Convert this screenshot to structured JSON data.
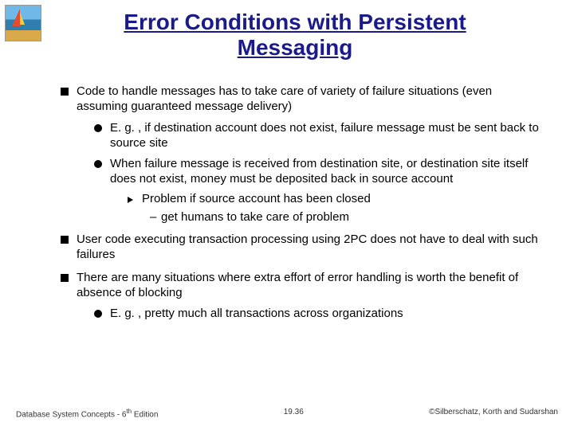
{
  "title": "Error Conditions with Persistent Messaging",
  "bullets": {
    "b1": "Code to handle messages has to take care of variety of failure situations (even assuming guaranteed message delivery)",
    "b1a": "E. g. , if destination account does not exist, failure message must be sent back to source site",
    "b1b": "When failure message is received from destination site, or destination site itself does not exist, money must be deposited back in source account",
    "b1b1": "Problem if source account has been closed",
    "b1b1a": "get humans to take care of problem",
    "b2": "User code executing transaction processing using 2PC does not have to deal with such failures",
    "b3": "There are many situations where extra effort of error handling is worth the benefit of absence of blocking",
    "b3a": "E. g. , pretty much all transactions across organizations"
  },
  "footer": {
    "left_pre": "Database System Concepts - 6",
    "left_sup": "th",
    "left_post": " Edition",
    "center": "19.36",
    "right": "©Silberschatz, Korth and Sudarshan"
  }
}
